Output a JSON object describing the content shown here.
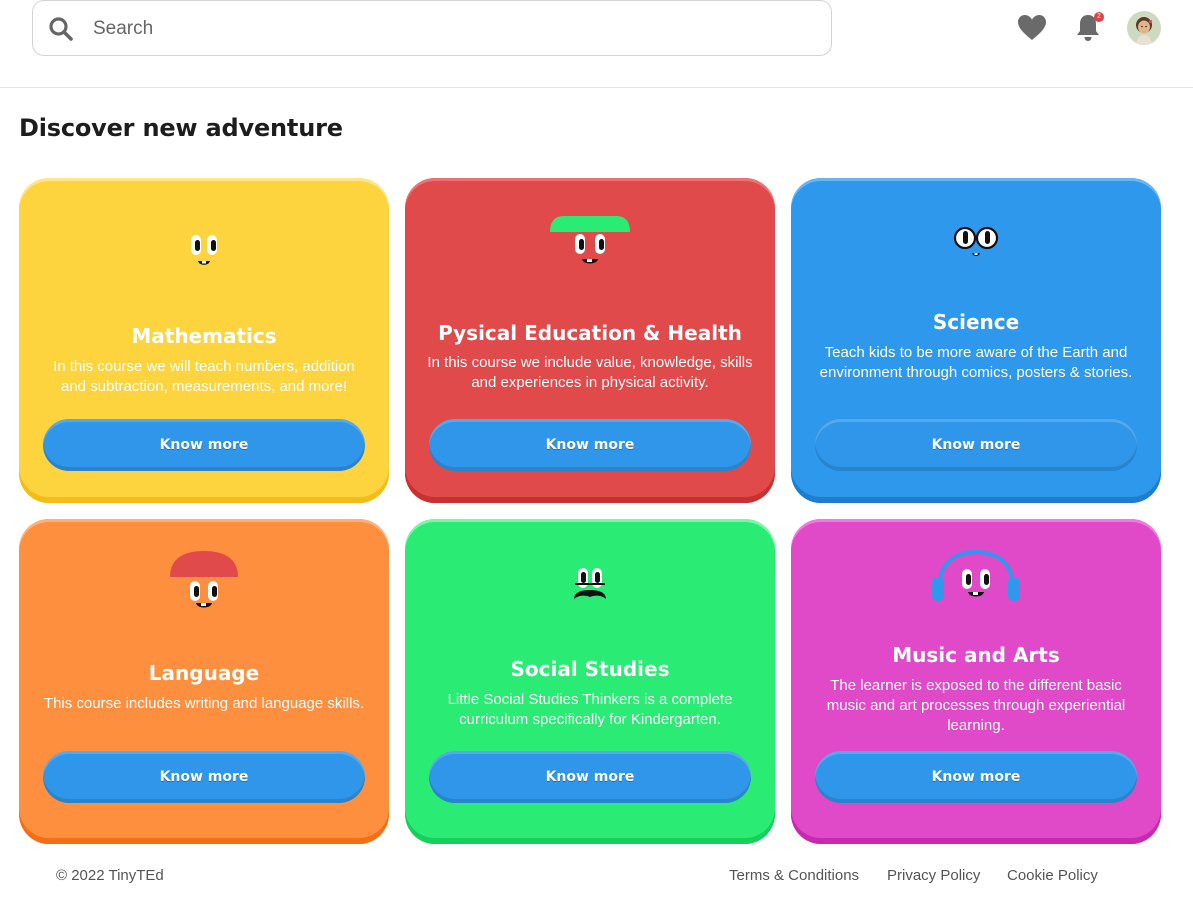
{
  "header": {
    "search": {
      "placeholder": "Search",
      "value": ""
    },
    "notification_count": "2"
  },
  "main": {
    "title": "Discover new adventure",
    "cards": [
      {
        "title": "Mathematics",
        "description": "In this course we will teach numbers, addition and subtraction, measurements, and more!",
        "button": "Know more",
        "color": "#fdd43e"
      },
      {
        "title": "Pysical Education & Health",
        "description": "In this course we include value, knowledge, skills and experiences in physical activity.",
        "button": "Know more",
        "color": "#e04a4b"
      },
      {
        "title": "Science",
        "description": "Teach kids to be more aware of the Earth and environment through comics, posters & stories.",
        "button": "Know more",
        "color": "#2e98ec"
      },
      {
        "title": "Language",
        "description": "This course includes writing and language skills.",
        "button": "Know more",
        "color": "#fd8f3f"
      },
      {
        "title": "Social Studies",
        "description": "Little Social Studies Thinkers is a complete curriculum specifically for Kindergarten.",
        "button": "Know more",
        "color": "#2aeb74"
      },
      {
        "title": "Music and Arts",
        "description": "The learner is exposed to the different basic music and art processes through experiential learning.",
        "button": "Know more",
        "color": "#e04ac9"
      }
    ]
  },
  "footer": {
    "copyright": "© 2022 TinyTEd",
    "links": [
      "Terms & Conditions",
      "Privacy Policy",
      "Cookie Policy"
    ]
  },
  "colors": {
    "button": "#2f96ea",
    "badge": "#e34141"
  }
}
